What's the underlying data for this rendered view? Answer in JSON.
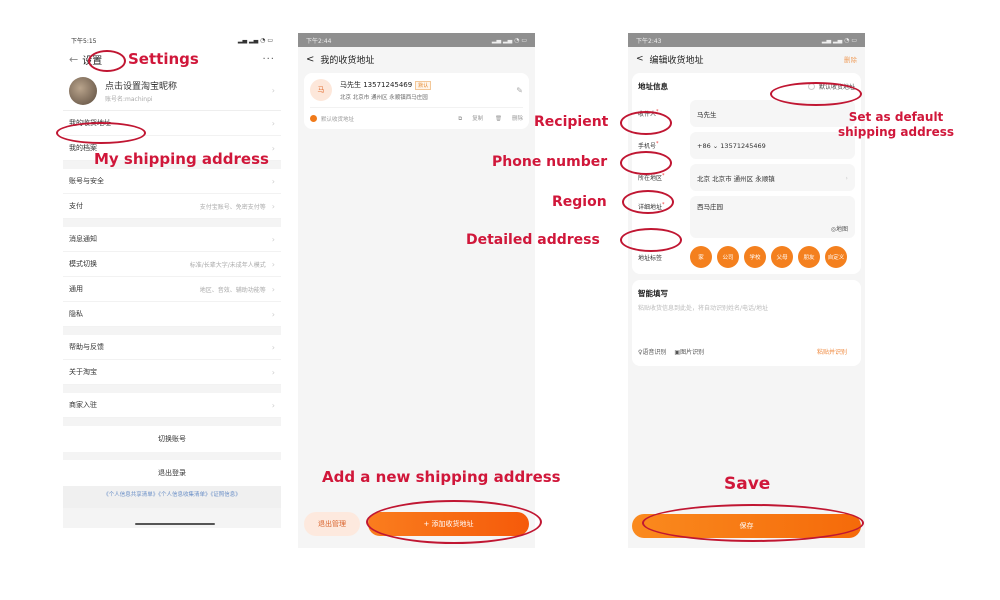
{
  "phone1": {
    "status_time": "下午5:15",
    "status_icons": "▂▄ ▂▄ ◔ ▭",
    "nav": {
      "back": "←",
      "title": "设置",
      "more": "···"
    },
    "profile": {
      "name": "点击设置淘宝昵称",
      "account": "账号名:machinpi"
    },
    "rows_group1": [
      {
        "label": "我的收货地址",
        "sub": ""
      },
      {
        "label": "我的档案",
        "sub": ""
      }
    ],
    "rows_group2": [
      {
        "label": "账号与安全",
        "sub": ""
      },
      {
        "label": "支付",
        "sub": "支付宝账号、免密支付等"
      }
    ],
    "rows_group3": [
      {
        "label": "消息通知",
        "sub": ""
      },
      {
        "label": "模式切换",
        "sub": "标准/长辈大字/未成年人模式"
      },
      {
        "label": "通用",
        "sub": "地区、音效、辅助功能等"
      },
      {
        "label": "隐私",
        "sub": ""
      }
    ],
    "rows_group4": [
      {
        "label": "帮助与反馈",
        "sub": ""
      },
      {
        "label": "关于淘宝",
        "sub": ""
      }
    ],
    "rows_group5": [
      {
        "label": "商家入驻",
        "sub": ""
      }
    ],
    "switch_account": "切换账号",
    "logout": "退出登录",
    "links": "《个人信息共享清单》《个人信息收集清单》《证照信息》"
  },
  "phone2": {
    "status_time": "下午2:44",
    "status_icons": "▂▄ ▂▄ ◔ ▭",
    "nav": {
      "back": "<",
      "title": "我的收货地址"
    },
    "address": {
      "avatar_char": "马",
      "name_phone": "马先生 13571245469",
      "badge": "默认",
      "detail": "北京 北京市 通州区 永顺镇西马庄园",
      "default_label": "默认收货地址",
      "copy": "复制",
      "delete": "删除"
    },
    "exit_manage": "退出管理",
    "add_button": "+ 添加收货地址"
  },
  "phone3": {
    "status_time": "下午2:43",
    "status_icons": "▂▄ ▂▄ ◔ ▭",
    "nav": {
      "back": "<",
      "title": "编辑收货地址",
      "delete": "删除"
    },
    "section_title": "地址信息",
    "default_toggle": "默认收货地址",
    "fields": {
      "recipient": {
        "label": "收件人",
        "value": "马先生"
      },
      "phone": {
        "label": "手机号",
        "value": "+86 ⌄  13571245469"
      },
      "region": {
        "label": "所在地区",
        "value": "北京 北京市 通州区 永顺镇"
      },
      "detail": {
        "label": "详细地址",
        "value": "西马庄园",
        "map": "◎地图"
      }
    },
    "tags_label": "地址标签",
    "tags": [
      "家",
      "公司",
      "学校",
      "父母",
      "朋友",
      "自定义"
    ],
    "smart": {
      "title": "智能填写",
      "placeholder": "粘贴收货信息到此处，将自动识别姓名/电话/地址",
      "voice": "♀语音识别",
      "image": "▣图片识别",
      "paste": "粘贴并识别"
    },
    "save": "保存"
  },
  "annotations": {
    "settings": "Settings",
    "my_shipping": "My shipping address",
    "add_new": "Add a new shipping address",
    "recipient": "Recipient",
    "phone": "Phone number",
    "region": "Region",
    "detailed": "Detailed address",
    "set_default_1": "Set as default",
    "set_default_2": "shipping address",
    "save": "Save"
  },
  "colors": {
    "accent": "#f56a0a",
    "annotation": "#d0173a"
  }
}
